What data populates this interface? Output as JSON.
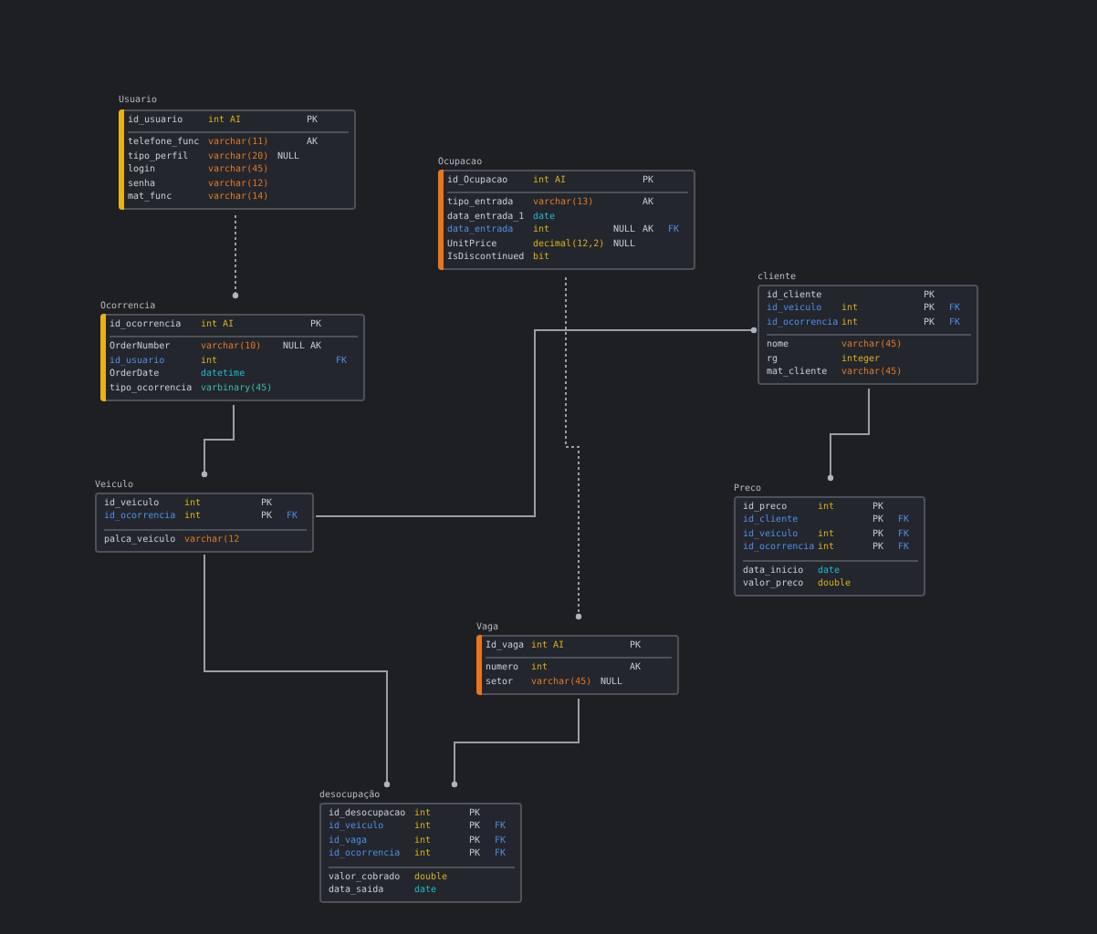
{
  "diagram": {
    "tables": [
      {
        "name": "Usuario",
        "color": "#e8b21a",
        "key_columns": [
          {
            "name": "id_usuario",
            "foreign": false,
            "type": "int AI",
            "kind": "number",
            "key": "PK"
          }
        ],
        "columns": [
          {
            "name": "telefone_func",
            "foreign": false,
            "type": "varchar(11)",
            "kind": "text",
            "key": "AK"
          },
          {
            "name": "tipo_perfil",
            "foreign": false,
            "type": "varchar(20)",
            "kind": "text",
            "null": "NULL"
          },
          {
            "name": "login",
            "foreign": false,
            "type": "varchar(45)",
            "kind": "text"
          },
          {
            "name": "senha",
            "foreign": false,
            "type": "varchar(12)",
            "kind": "text"
          },
          {
            "name": "mat_func",
            "foreign": false,
            "type": "varchar(14)",
            "kind": "text"
          }
        ]
      },
      {
        "name": "Ocupacao",
        "color": "#e8761c",
        "key_columns": [
          {
            "name": "id_Ocupacao",
            "foreign": false,
            "type": "int AI",
            "kind": "number",
            "key": "PK"
          }
        ],
        "columns": [
          {
            "name": "tipo_entrada",
            "foreign": false,
            "type": "varchar(13)",
            "kind": "text",
            "key": "AK"
          },
          {
            "name": "data_entrada_1",
            "foreign": false,
            "type": "date",
            "kind": "date"
          },
          {
            "name": "data_entrada",
            "foreign": true,
            "type": "int",
            "kind": "number",
            "null": "NULL",
            "key": "AK",
            "fk": "FK"
          },
          {
            "name": "UnitPrice",
            "foreign": false,
            "type": "decimal(12,2)",
            "kind": "number",
            "null": "NULL"
          },
          {
            "name": "IsDiscontinued",
            "foreign": false,
            "type": "bit",
            "kind": "number"
          }
        ]
      },
      {
        "name": "cliente",
        "key_columns": [
          {
            "name": "id_cliente",
            "foreign": false,
            "key": "PK"
          },
          {
            "name": "id_veiculo",
            "foreign": true,
            "type": "int",
            "kind": "number",
            "key": "PK",
            "fk": "FK"
          },
          {
            "name": "id_ocorrencia",
            "foreign": true,
            "type": "int",
            "kind": "number",
            "key": "PK",
            "fk": "FK"
          }
        ],
        "columns": [
          {
            "name": "nome",
            "foreign": false,
            "type": "varchar(45)",
            "kind": "text"
          },
          {
            "name": "rg",
            "foreign": false,
            "type": "integer",
            "kind": "number"
          },
          {
            "name": "mat_cliente",
            "foreign": false,
            "type": "varchar(45)",
            "kind": "text"
          }
        ]
      },
      {
        "name": "Ocorrencia",
        "color": "#e8b21a",
        "key_columns": [
          {
            "name": "id_ocorrencia",
            "foreign": false,
            "type": "int AI",
            "kind": "number",
            "key": "PK"
          }
        ],
        "columns": [
          {
            "name": "OrderNumber",
            "foreign": false,
            "type": "varchar(10)",
            "kind": "text",
            "null": "NULL",
            "key": "AK"
          },
          {
            "name": "id_usuario",
            "foreign": true,
            "type": "int",
            "kind": "number",
            "fk": "FK"
          },
          {
            "name": "OrderDate",
            "foreign": false,
            "type": "datetime",
            "kind": "date"
          },
          {
            "name": "tipo_ocorrencia",
            "foreign": false,
            "type": "varbinary(45)",
            "kind": "binary"
          }
        ]
      },
      {
        "name": "Veiculo",
        "key_columns": [
          {
            "name": "id_veiculo",
            "foreign": false,
            "type": "int",
            "kind": "number",
            "key": "PK"
          },
          {
            "name": "id_ocorrencia",
            "foreign": true,
            "type": "int",
            "kind": "number",
            "key": "PK",
            "fk": "FK"
          }
        ],
        "columns": [
          {
            "name": "palca_veiculo",
            "foreign": false,
            "type": "varchar(12",
            "kind": "text"
          }
        ]
      },
      {
        "name": "Preco",
        "key_columns": [
          {
            "name": "id_preco",
            "foreign": false,
            "type": "int",
            "kind": "number",
            "key": "PK"
          },
          {
            "name": "id_cliente",
            "foreign": true,
            "key": "PK",
            "fk": "FK"
          },
          {
            "name": "id_veiculo",
            "foreign": true,
            "type": "int",
            "kind": "number",
            "key": "PK",
            "fk": "FK"
          },
          {
            "name": "id_ocorrencia",
            "foreign": true,
            "type": "int",
            "kind": "number",
            "key": "PK",
            "fk": "FK"
          }
        ],
        "columns": [
          {
            "name": "data_inicio",
            "foreign": false,
            "type": "date",
            "kind": "date"
          },
          {
            "name": "valor_preco",
            "foreign": false,
            "type": "double",
            "kind": "number"
          }
        ]
      },
      {
        "name": "Vaga",
        "color": "#e8761c",
        "key_columns": [
          {
            "name": "Id_vaga",
            "foreign": false,
            "type": "int AI",
            "kind": "number",
            "key": "PK"
          }
        ],
        "columns": [
          {
            "name": "numero",
            "foreign": false,
            "type": "int",
            "kind": "number",
            "key": "AK"
          },
          {
            "name": "setor",
            "foreign": false,
            "type": "varchar(45)",
            "kind": "text",
            "null": "NULL"
          }
        ]
      },
      {
        "name": "desocupação",
        "key_columns": [
          {
            "name": "id_desocupacao",
            "foreign": false,
            "type": "int",
            "kind": "number",
            "key": "PK"
          },
          {
            "name": "id_veiculo",
            "foreign": true,
            "type": "int",
            "kind": "number",
            "key": "PK",
            "fk": "FK"
          },
          {
            "name": "id_vaga",
            "foreign": true,
            "type": "int",
            "kind": "number",
            "key": "PK",
            "fk": "FK"
          },
          {
            "name": "id_ocorrencia",
            "foreign": true,
            "type": "int",
            "kind": "number",
            "key": "PK",
            "fk": "FK"
          }
        ],
        "columns": [
          {
            "name": "valor_cobrado",
            "foreign": false,
            "type": "double",
            "kind": "number"
          },
          {
            "name": "data_saida",
            "foreign": false,
            "type": "date",
            "kind": "date"
          }
        ]
      }
    ],
    "relationships": [
      {
        "kind": "dashed"
      },
      {
        "kind": "dashed"
      },
      {
        "kind": "solid"
      },
      {
        "kind": "solid"
      },
      {
        "kind": "solid"
      },
      {
        "kind": "solid"
      },
      {
        "kind": "solid"
      }
    ]
  }
}
